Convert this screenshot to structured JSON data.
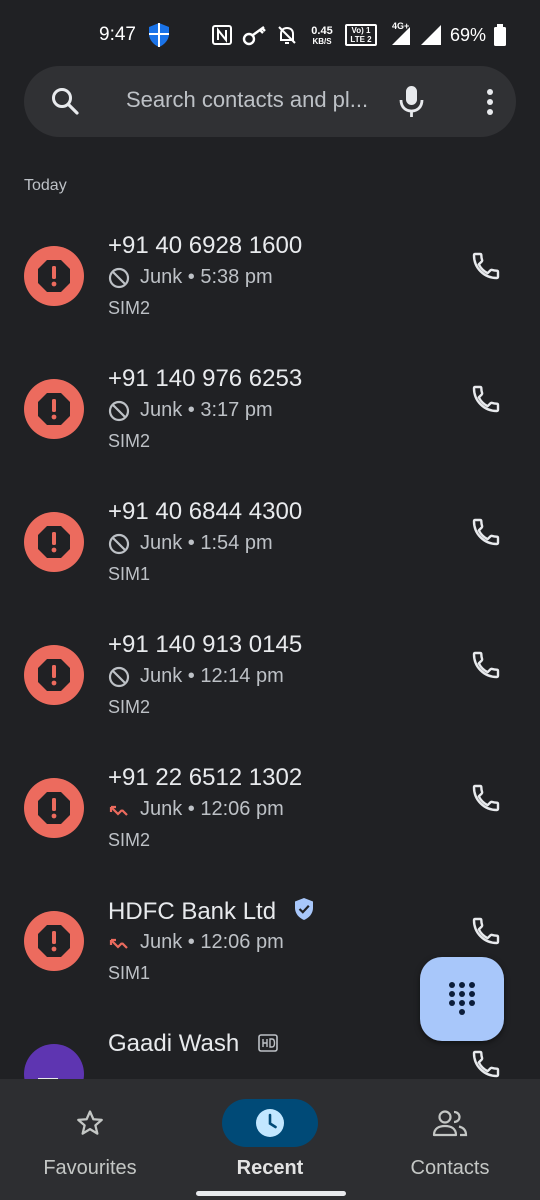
{
  "status_bar": {
    "time": "9:47",
    "data_speed_value": "0.45",
    "data_speed_unit": "KB/S",
    "volte_top": "Vo) 1",
    "volte_bottom": "LTE 2",
    "network": "4G+",
    "battery": "69%",
    "icons": [
      "shield-icon",
      "nfc-icon",
      "vpn-key-icon",
      "bell-off-icon",
      "signal-icon",
      "battery-icon"
    ]
  },
  "search": {
    "placeholder": "Search contacts and pl..."
  },
  "section_header": "Today",
  "calls": [
    {
      "name": "+91 40 6928 1600",
      "type_icon": "blocked-icon",
      "type": "Junk",
      "time": "5:38 pm",
      "sim": "SIM2"
    },
    {
      "name": "+91 140 976 6253",
      "type_icon": "blocked-icon",
      "type": "Junk",
      "time": "3:17 pm",
      "sim": "SIM2"
    },
    {
      "name": "+91 40 6844 4300",
      "type_icon": "blocked-icon",
      "type": "Junk",
      "time": "1:54 pm",
      "sim": "SIM1"
    },
    {
      "name": "+91 140 913 0145",
      "type_icon": "blocked-icon",
      "type": "Junk",
      "time": "12:14 pm",
      "sim": "SIM2"
    },
    {
      "name": "+91 22 6512 1302",
      "type_icon": "missed-call-icon",
      "type": "Junk",
      "time": "12:06 pm",
      "sim": "SIM2"
    },
    {
      "name": "HDFC Bank Ltd",
      "type_icon": "missed-call-icon",
      "type": "Junk",
      "time": "12:06 pm",
      "sim": "SIM1",
      "verified": true
    },
    {
      "name": "Gaadi Wash",
      "hd": true,
      "avatar": "business-icon"
    }
  ],
  "bottom_nav": [
    {
      "label": "Favourites",
      "icon": "star-icon",
      "active": false
    },
    {
      "label": "Recent",
      "icon": "clock-icon",
      "active": true
    },
    {
      "label": "Contacts",
      "icon": "people-icon",
      "active": false
    }
  ],
  "colors": {
    "background": "#202124",
    "junk_red": "#ec6b5e",
    "fab": "#a8c7fa",
    "nav_active": "#004a77"
  }
}
